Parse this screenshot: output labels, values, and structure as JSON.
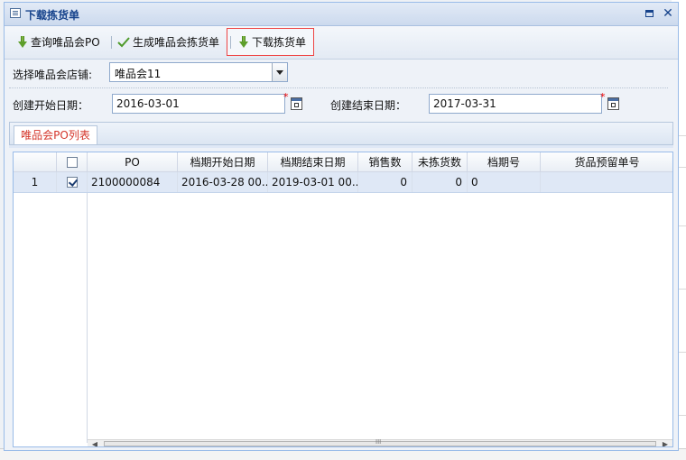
{
  "window": {
    "title": "下载拣货单",
    "icons": {
      "title": "table-icon",
      "maximize": "maximize-icon",
      "close": "close-icon"
    },
    "close_glyph": "✕"
  },
  "toolbar": {
    "query_label": "查询唯品会PO",
    "generate_label": "生成唯品会拣货单",
    "download_label": "下载拣货单"
  },
  "form": {
    "store_label": "选择唯品会店铺:",
    "store_value": "唯品会11",
    "start_label": "创建开始日期：",
    "start_value": "2016-03-01",
    "end_label": "创建结束日期：",
    "end_value": "2017-03-31",
    "required_mark": "*"
  },
  "tabs": [
    {
      "label": "唯品会PO列表"
    }
  ],
  "grid": {
    "columns": [
      "PO",
      "档期开始日期",
      "档期结束日期",
      "销售数",
      "未拣货数",
      "档期号",
      "货品预留单号"
    ],
    "rows": [
      {
        "num": "1",
        "checked": true,
        "po": "2100000084",
        "start": "2016-03-28 00...",
        "end": "2019-03-01 00...",
        "sales": "0",
        "unpicked": "0",
        "schedule": "0",
        "reserve": ""
      }
    ],
    "scroll_thumb_glyph": "III",
    "scroll_left": "◀",
    "scroll_right": "▶"
  },
  "colors": {
    "accent": "#15428b",
    "highlight_border": "#e44444",
    "tab_text": "#d4352a",
    "selected_row": "#dfe8f6"
  }
}
